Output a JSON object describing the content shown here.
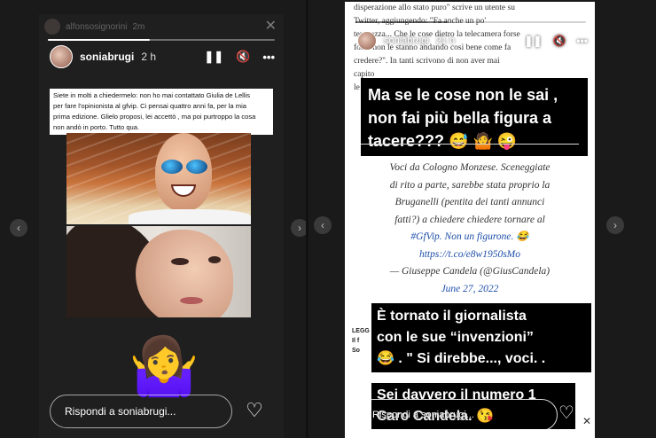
{
  "left_story": {
    "ghost_username": "alfonsosignorini",
    "ghost_time": "2m",
    "username": "soniabrugi",
    "time": "2 h",
    "progress": 0.45,
    "caption_lines": [
      "Siete in molti a chiedermelo: non ho mai contattato Giulia de Lellis",
      "per fare l'opinionista al gfvip. Ci pensai quattro anni fa, per la mia",
      "prima edizione. Glielo proposi, lei accettò , ma poi purtroppo la cosa",
      "non andò in porto. Tutto qua."
    ],
    "sticker_emoji": "🤷‍♀️",
    "reply_placeholder": "Rispondi a soniabrugi...",
    "pause_icon": "❚❚",
    "mute_icon": "🔇",
    "more_icon": "•••",
    "heart_icon": "♡"
  },
  "nav": {
    "left_arrow": "‹",
    "mid_arrow": "›",
    "mid_left_arrow": "‹",
    "right_arrow": "›"
  },
  "right_story": {
    "article_lines": [
      "disperazione allo stato puro\" scrive un utente su",
      "Twitter, aggiungendo: \"Fa anche un po'",
      "tenerezza... Che le cose dietro la telecamera forse",
      "forse non le stanno andando così bene come fa",
      "credere?\". In tanti scrivono di non aver mai",
      "capito",
      "le"
    ],
    "username": "soniabrugi",
    "time": "21 h",
    "progress": 0.4,
    "box1_lines": [
      "Ma se le cose non le sai ,",
      "non fai più bella figura a",
      "tacere??? 😅 🤷 😜"
    ],
    "tweet_lines": [
      "Voci da Cologno Monzese. Sceneggiate",
      "di rito a parte, sarebbe stata proprio la",
      "Bruganelli (pentita dei tanti annunci",
      "fatti?) a chiedere chiedere tornare al",
      "#GfVip. Non un figurone. 😂",
      "https://t.co/e8w1950sMo",
      "— Giuseppe Candela (@GiusCandela)",
      "June 27, 2022"
    ],
    "side_snip": [
      "LEGG",
      "Il f",
      "So"
    ],
    "box2_lines": [
      "È tornato il giornalista",
      "con le sue “invenzioni”",
      "😂 .  \" Si direbbe..., voci. ."
    ],
    "box3_lines": [
      "Sei davvero il numero 1",
      "Caro Candela. 😘"
    ],
    "reply_placeholder": "Rispondi a soniabrugi...",
    "pause_icon": "❚❚",
    "mute_icon": "🔇",
    "more_icon": "•••",
    "heart_icon": "♡",
    "close_icon": "✕"
  }
}
